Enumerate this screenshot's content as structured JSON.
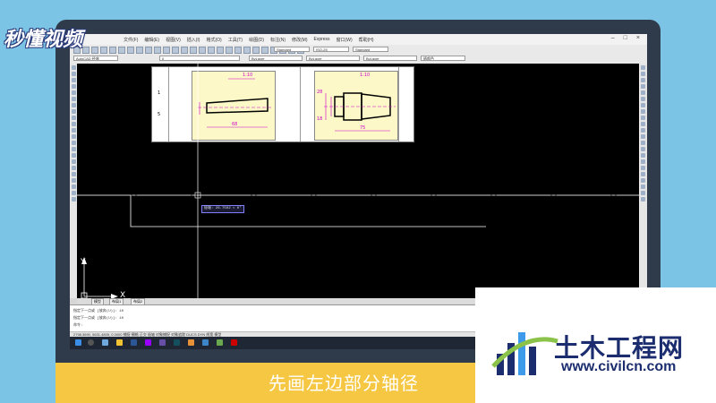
{
  "overlay": {
    "logo_top_left": "秒懂视频",
    "subtitle": "先画左边部分轴径",
    "watermark_cn": "土木工程网",
    "watermark_url": "www.civilcn.com"
  },
  "app": {
    "menus": [
      "文件(F)",
      "编辑(E)",
      "视图(V)",
      "插入(I)",
      "格式(O)",
      "工具(T)",
      "绘图(D)",
      "标注(N)",
      "修改(M)",
      "Express",
      "窗口(W)",
      "帮助(H)"
    ],
    "combos": {
      "text_style": "Standard",
      "dim_style": "ISO-25",
      "table_style": "Standard",
      "workspace": "AutoCAD 经典",
      "layer": "ByLayer",
      "linetype": "ByLayer",
      "lineweight": "ByLayer",
      "plotstyle": "随颜色"
    },
    "canvas": {
      "dynamic_input": "极轴: 26.7502 < 0°",
      "ucs_x": "X",
      "ucs_y": "Y",
      "reference_dims": {
        "left_taper": "1:10",
        "left_length": "68",
        "right_taper": "1:10",
        "right_length": "75",
        "right_d1": "28",
        "right_d2": "18",
        "row_label_a": "1",
        "row_label_b": "5"
      }
    },
    "tabs": [
      "模型",
      "布局1",
      "布局2"
    ],
    "command_lines": [
      "指定下一点或 [放弃(U)]: 10",
      "指定下一点或 [放弃(U)]: 10",
      "命令:"
    ],
    "status_text": "2798.3690, 5631.4805, 0.0000   捕捉 栅格 正交 极轴 对象捕捉 对象追踪 DUCS DYN 线宽 模型"
  },
  "colors": {
    "background": "#7cc4e6",
    "monitor": "#2f3b4a",
    "canvas": "#000000",
    "subtitle_bar": "#f6c742",
    "brand_blue": "#1b2d6e"
  }
}
